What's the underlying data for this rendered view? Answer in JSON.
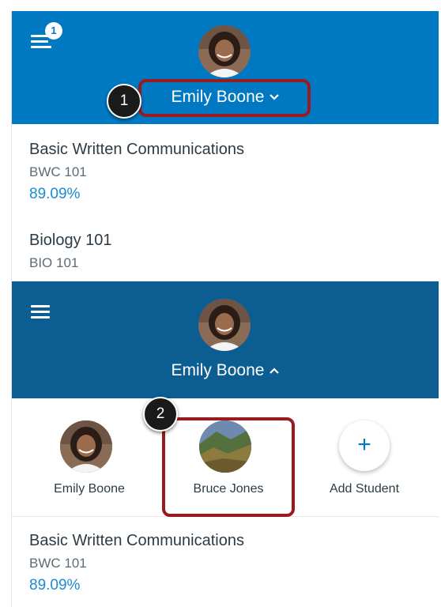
{
  "top_bar": {
    "notification_count": "1",
    "student_name": "Emily Boone",
    "bg_color": "#0079C2"
  },
  "courses_top": [
    {
      "name": "Basic Written Communications",
      "code": "BWC 101",
      "grade": "89.09%"
    },
    {
      "name": "Biology 101",
      "code": "BIO 101"
    }
  ],
  "expanded_bar": {
    "student_name": "Emily Boone",
    "bg_color": "#0c5e92"
  },
  "student_picker": {
    "students": [
      {
        "name": "Emily Boone"
      },
      {
        "name": "Bruce Jones"
      }
    ],
    "add_label": "Add Student",
    "add_symbol": "+"
  },
  "courses_bottom": [
    {
      "name": "Basic Written Communications",
      "code": "BWC 101",
      "grade": "89.09%"
    }
  ],
  "callouts": {
    "step1": "1",
    "step2": "2",
    "highlight_color": "#9a1b1f"
  },
  "icons": {
    "menu": "hamburger-menu-icon",
    "chevron_down": "chevron-down-icon",
    "chevron_up": "chevron-up-icon",
    "add": "plus-icon"
  }
}
